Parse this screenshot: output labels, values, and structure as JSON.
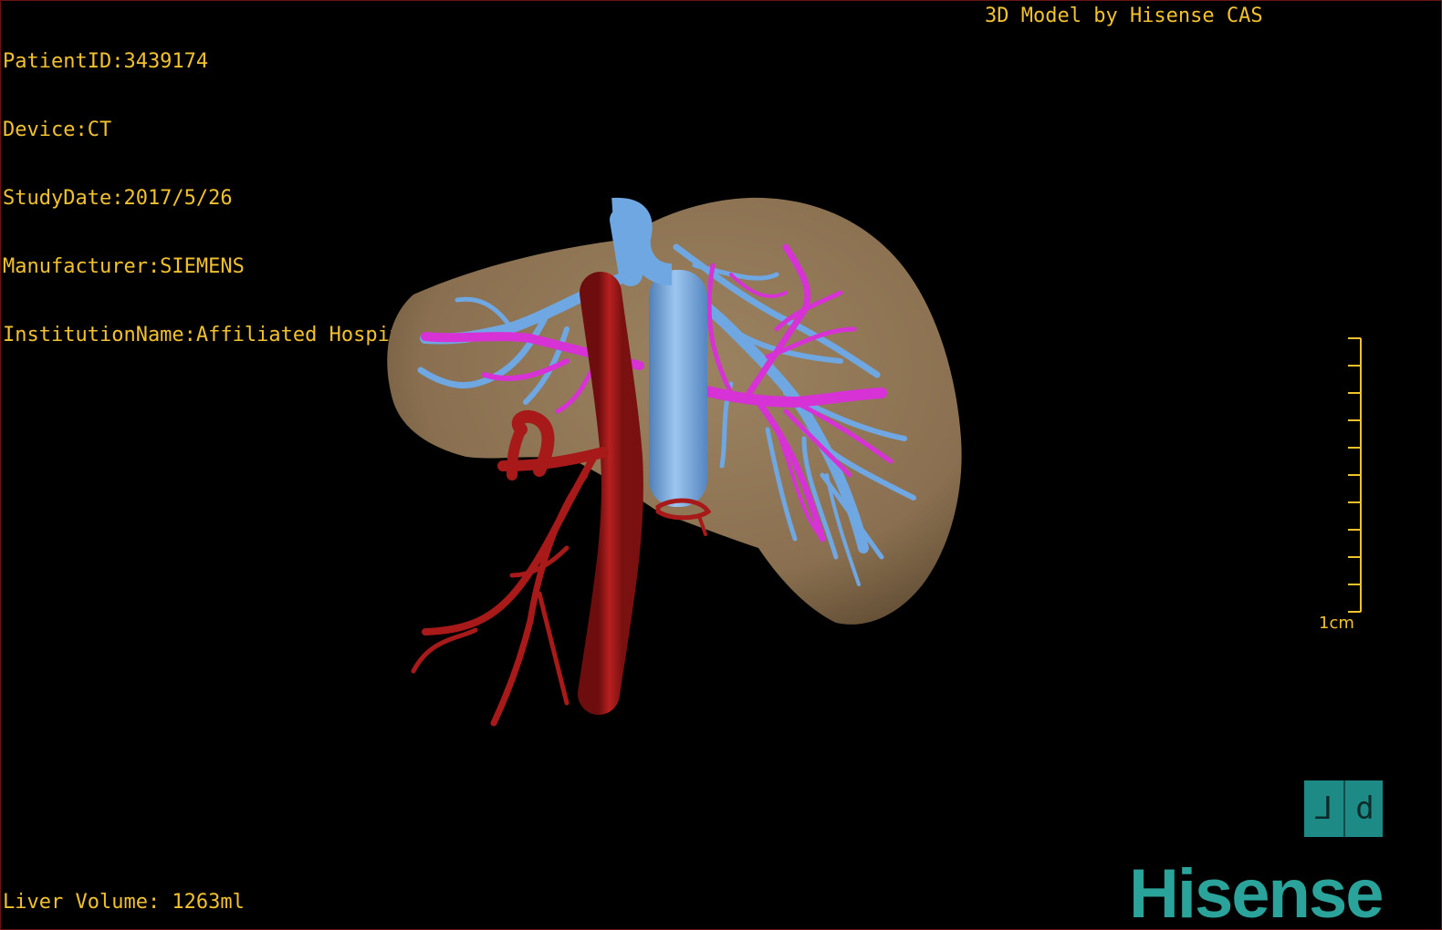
{
  "overlay": {
    "patient_id": "PatientID:3439174",
    "device": "Device:CT",
    "study_date": "StudyDate:2017/5/26",
    "manufacturer": "Manufacturer:SIEMENS",
    "institution": "InstitutionName:Affiliated Hospital Qingdao University-C",
    "top_right": "3D Model by Hisense CAS",
    "liver_volume": "Liver Volume: 1263ml"
  },
  "scale": {
    "label": "1cm"
  },
  "orientation_button": {
    "left_glyph": "⅃",
    "right_glyph": "d"
  },
  "brand": {
    "name": "Hisense"
  },
  "colors": {
    "overlay_text": "#f2c12e",
    "liver": "#8f7552",
    "portal_vein": "#6fa7e3",
    "hepatic_vein": "#d632d6",
    "artery": "#a81a1a",
    "brand": "#2aa39a"
  }
}
